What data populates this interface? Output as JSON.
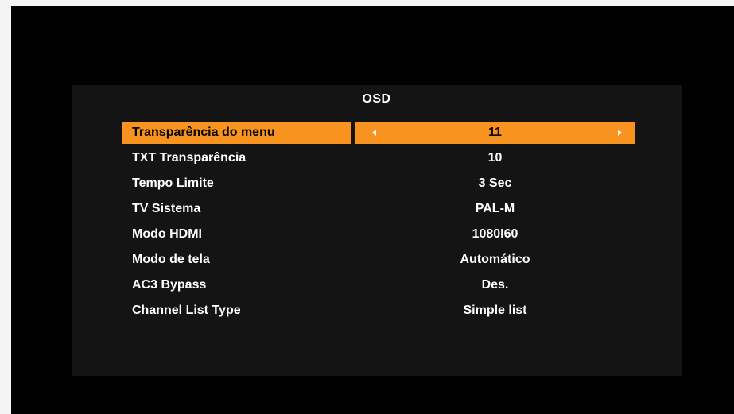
{
  "colors": {
    "accent": "#f7931e",
    "panel": "#141414",
    "screen": "#000000",
    "text": "#ffffff"
  },
  "menu": {
    "title": "OSD",
    "selected_index": 0,
    "items": [
      {
        "label": "Transparência do menu",
        "value": "11"
      },
      {
        "label": "TXT Transparência",
        "value": "10"
      },
      {
        "label": "Tempo Limite",
        "value": "3 Sec"
      },
      {
        "label": "TV Sistema",
        "value": "PAL-M"
      },
      {
        "label": "Modo HDMI",
        "value": "1080I60"
      },
      {
        "label": "Modo de tela",
        "value": "Automático"
      },
      {
        "label": "AC3 Bypass",
        "value": "Des."
      },
      {
        "label": "Channel List Type",
        "value": "Simple list"
      }
    ],
    "icons": {
      "left": "arrow-left-icon",
      "right": "arrow-right-icon"
    }
  }
}
